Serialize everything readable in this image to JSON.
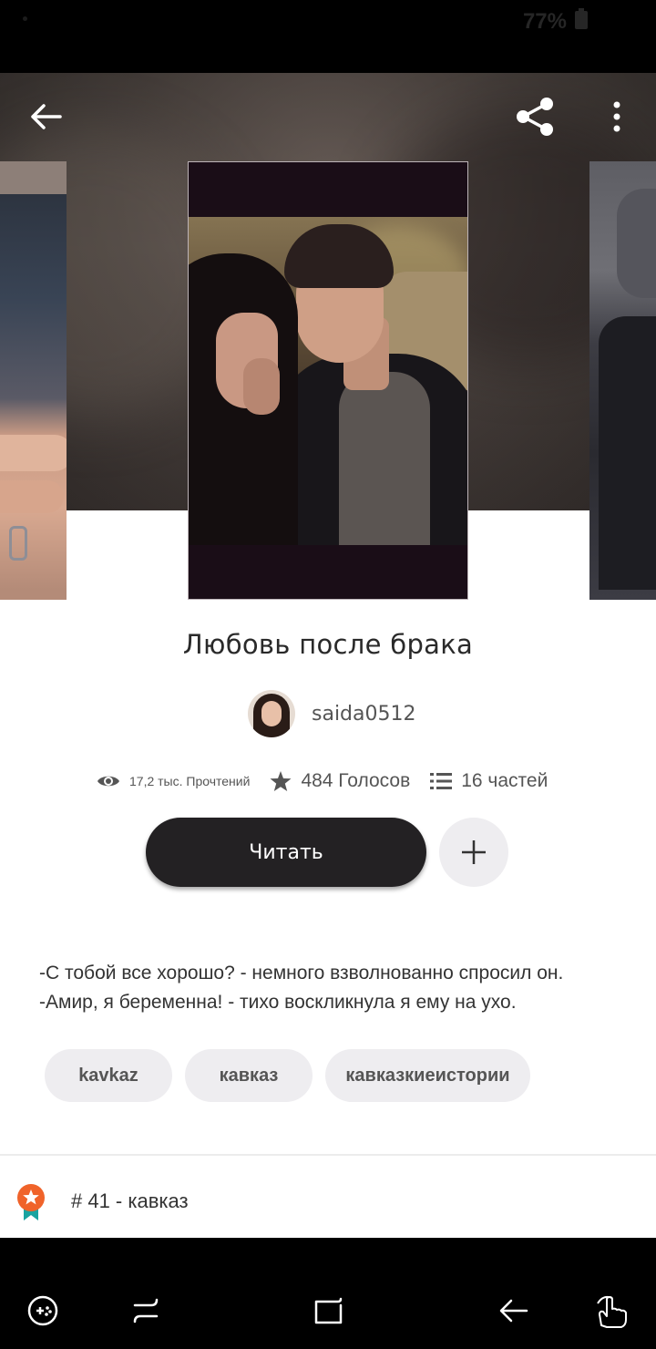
{
  "status_bar": {
    "battery": "77%"
  },
  "app_bar": {
    "back_icon": "arrow-back-icon",
    "share_icon": "share-icon",
    "more_icon": "more-vertical-icon"
  },
  "story": {
    "title": "Любовь после брака",
    "author": "saida0512",
    "stats": {
      "reads": "17,2 тыс. Прочтений",
      "votes": "484 Голосов",
      "parts": "16 частей"
    },
    "read_button": "Читать",
    "description": [
      "-С тобой все хорошо? - немного взволнованно спросил он.",
      "-Амир, я беременна! - тихо воскликнула я ему на ухо."
    ],
    "tags": [
      "kavkaz",
      "кавказ",
      "кавказкиеистории"
    ],
    "rank": "# 41 - кавказ"
  },
  "colors": {
    "button_dark": "#232123",
    "chip_bg": "#eeedf0",
    "rank_orange": "#f0632a",
    "rank_teal": "#1aa3a0"
  },
  "nav_bar": {
    "icons": [
      "game-tools-icon",
      "recent-apps-icon",
      "home-icon",
      "back-icon",
      "touch-icon"
    ]
  }
}
